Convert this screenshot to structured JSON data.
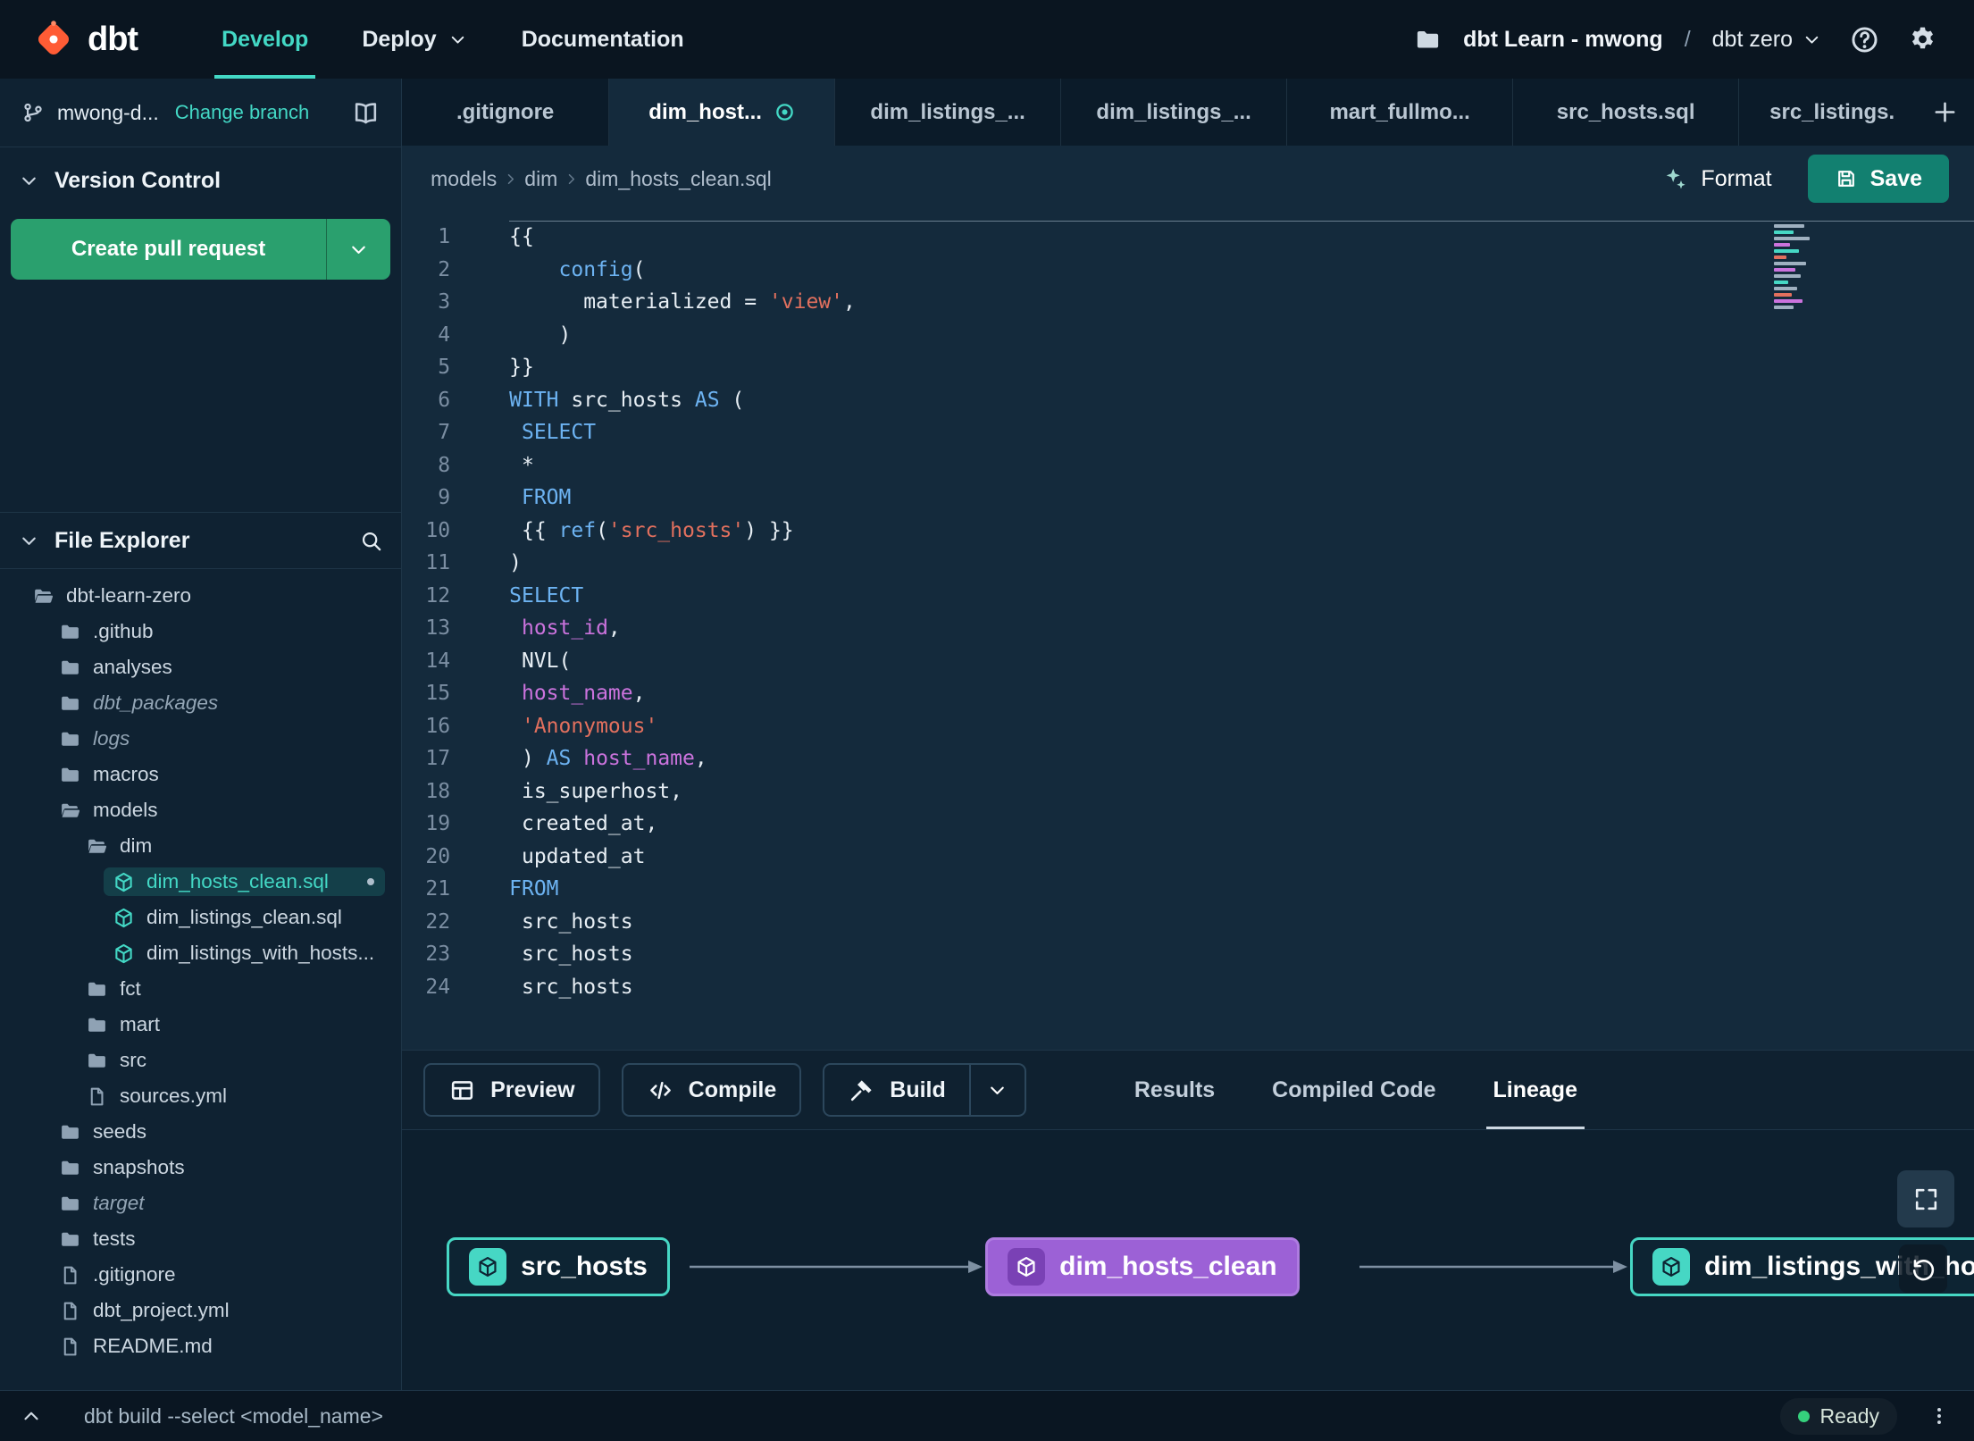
{
  "navbar": {
    "logo": "dbt",
    "nav": [
      {
        "label": "Develop",
        "active": true
      },
      {
        "label": "Deploy",
        "dropdown": true
      },
      {
        "label": "Documentation"
      }
    ],
    "project": "dbt Learn - mwong",
    "path_sep": "/",
    "environment": "dbt zero"
  },
  "sidebar": {
    "branch_name": "mwong-d...",
    "change_branch": "Change branch",
    "version_control": "Version Control",
    "create_pull_request": "Create pull request",
    "file_explorer": "File Explorer",
    "tree": [
      {
        "label": "dbt-learn-zero",
        "icon": "folder-open-icon",
        "indent": 0
      },
      {
        "label": ".github",
        "icon": "folder-icon",
        "indent": 1
      },
      {
        "label": "analyses",
        "icon": "folder-icon",
        "indent": 1
      },
      {
        "label": "dbt_packages",
        "icon": "folder-icon",
        "indent": 1,
        "italic": true
      },
      {
        "label": "logs",
        "icon": "folder-icon",
        "indent": 1,
        "italic": true
      },
      {
        "label": "macros",
        "icon": "folder-icon",
        "indent": 1
      },
      {
        "label": "models",
        "icon": "folder-open-icon",
        "indent": 1
      },
      {
        "label": "dim",
        "icon": "folder-open-icon",
        "indent": 2
      },
      {
        "label": "dim_hosts_clean.sql",
        "icon": "model-icon",
        "indent": 3,
        "selected": true,
        "modified": true
      },
      {
        "label": "dim_listings_clean.sql",
        "icon": "model-icon",
        "indent": 3
      },
      {
        "label": "dim_listings_with_hosts...",
        "icon": "model-icon",
        "indent": 3
      },
      {
        "label": "fct",
        "icon": "folder-icon",
        "indent": 2
      },
      {
        "label": "mart",
        "icon": "folder-icon",
        "indent": 2
      },
      {
        "label": "src",
        "icon": "folder-icon",
        "indent": 2
      },
      {
        "label": "sources.yml",
        "icon": "file-icon",
        "indent": 2
      },
      {
        "label": "seeds",
        "icon": "folder-icon",
        "indent": 1
      },
      {
        "label": "snapshots",
        "icon": "folder-icon",
        "indent": 1
      },
      {
        "label": "target",
        "icon": "folder-icon",
        "indent": 1,
        "italic": true
      },
      {
        "label": "tests",
        "icon": "folder-icon",
        "indent": 1
      },
      {
        "label": ".gitignore",
        "icon": "file-icon",
        "indent": 1
      },
      {
        "label": "dbt_project.yml",
        "icon": "file-icon",
        "indent": 1
      },
      {
        "label": "README.md",
        "icon": "file-icon",
        "indent": 1
      }
    ]
  },
  "tabs": [
    {
      "label": ".gitignore"
    },
    {
      "label": "dim_host...",
      "active": true,
      "modified": true
    },
    {
      "label": "dim_listings_..."
    },
    {
      "label": "dim_listings_..."
    },
    {
      "label": "mart_fullmo..."
    },
    {
      "label": "src_hosts.sql"
    },
    {
      "label": "src_listings."
    }
  ],
  "breadcrumb": [
    "models",
    "dim",
    "dim_hosts_clean.sql"
  ],
  "actions": {
    "format": "Format",
    "save": "Save"
  },
  "code": {
    "lines": [
      {
        "n": 1,
        "s": [
          [
            "p",
            "{{"
          ]
        ]
      },
      {
        "n": 2,
        "s": [
          [
            "p",
            "    "
          ],
          [
            "k",
            "config"
          ],
          [
            "p",
            "("
          ]
        ]
      },
      {
        "n": 3,
        "s": [
          [
            "p",
            "      materialized = "
          ],
          [
            "s",
            "'view'"
          ],
          [
            "p",
            ","
          ]
        ]
      },
      {
        "n": 4,
        "s": [
          [
            "p",
            "    )"
          ]
        ]
      },
      {
        "n": 5,
        "s": [
          [
            "p",
            "}}"
          ]
        ]
      },
      {
        "n": 6,
        "s": [
          [
            "k",
            "WITH"
          ],
          [
            "p",
            " src_hosts "
          ],
          [
            "k",
            "AS"
          ],
          [
            "p",
            " ("
          ]
        ]
      },
      {
        "n": 7,
        "s": [
          [
            "p",
            " "
          ],
          [
            "k",
            "SELECT"
          ]
        ]
      },
      {
        "n": 8,
        "s": [
          [
            "p",
            " *"
          ]
        ]
      },
      {
        "n": 9,
        "s": [
          [
            "p",
            " "
          ],
          [
            "k",
            "FROM"
          ]
        ]
      },
      {
        "n": 10,
        "s": [
          [
            "p",
            " {{ "
          ],
          [
            "k",
            "ref"
          ],
          [
            "p",
            "("
          ],
          [
            "s",
            "'src_hosts'"
          ],
          [
            "p",
            ") }}"
          ]
        ]
      },
      {
        "n": 11,
        "s": [
          [
            "p",
            ")"
          ]
        ]
      },
      {
        "n": 12,
        "s": [
          [
            "k",
            "SELECT"
          ]
        ]
      },
      {
        "n": 13,
        "s": [
          [
            "p",
            " "
          ],
          [
            "m",
            "host_id"
          ],
          [
            "p",
            ","
          ]
        ]
      },
      {
        "n": 14,
        "s": [
          [
            "p",
            " NVL("
          ]
        ]
      },
      {
        "n": 15,
        "s": [
          [
            "p",
            " "
          ],
          [
            "m",
            "host_name"
          ],
          [
            "p",
            ","
          ]
        ]
      },
      {
        "n": 16,
        "s": [
          [
            "p",
            " "
          ],
          [
            "s",
            "'Anonymous'"
          ]
        ]
      },
      {
        "n": 17,
        "s": [
          [
            "p",
            " ) "
          ],
          [
            "k",
            "AS"
          ],
          [
            "p",
            " "
          ],
          [
            "m",
            "host_name"
          ],
          [
            "p",
            ","
          ]
        ]
      },
      {
        "n": 18,
        "s": [
          [
            "p",
            " is_superhost,"
          ]
        ]
      },
      {
        "n": 19,
        "s": [
          [
            "p",
            " created_at,"
          ]
        ]
      },
      {
        "n": 20,
        "s": [
          [
            "p",
            " updated_at"
          ]
        ]
      },
      {
        "n": 21,
        "s": [
          [
            "k",
            "FROM"
          ]
        ]
      },
      {
        "n": 22,
        "s": [
          [
            "p",
            " src_hosts"
          ]
        ]
      },
      {
        "n": 23,
        "s": [
          [
            "p",
            " src_hosts"
          ]
        ]
      },
      {
        "n": 24,
        "s": [
          [
            "p",
            " src_hosts"
          ]
        ]
      }
    ]
  },
  "panel": {
    "buttons": [
      {
        "label": "Preview",
        "icon": "table-icon"
      },
      {
        "label": "Compile",
        "icon": "code-icon"
      },
      {
        "label": "Build",
        "icon": "hammer-icon",
        "split": true
      }
    ],
    "tabs": [
      {
        "label": "Results"
      },
      {
        "label": "Compiled Code"
      },
      {
        "label": "Lineage",
        "active": true
      }
    ]
  },
  "lineage": {
    "nodes": [
      {
        "label": "src_hosts",
        "color": "teal"
      },
      {
        "label": "dim_hosts_clean",
        "color": "purple"
      },
      {
        "label": "dim_listings_with_hosts",
        "color": "teal"
      }
    ]
  },
  "statusbar": {
    "command": "dbt build --select <model_name>",
    "status": "Ready"
  },
  "colors": {
    "accent_teal": "#43d8c5",
    "brand_orange": "#ff5c35",
    "node_purple": "#9c61d6",
    "status_green": "#35d07c",
    "button_green": "#2aa06e",
    "save_teal": "#128070"
  }
}
